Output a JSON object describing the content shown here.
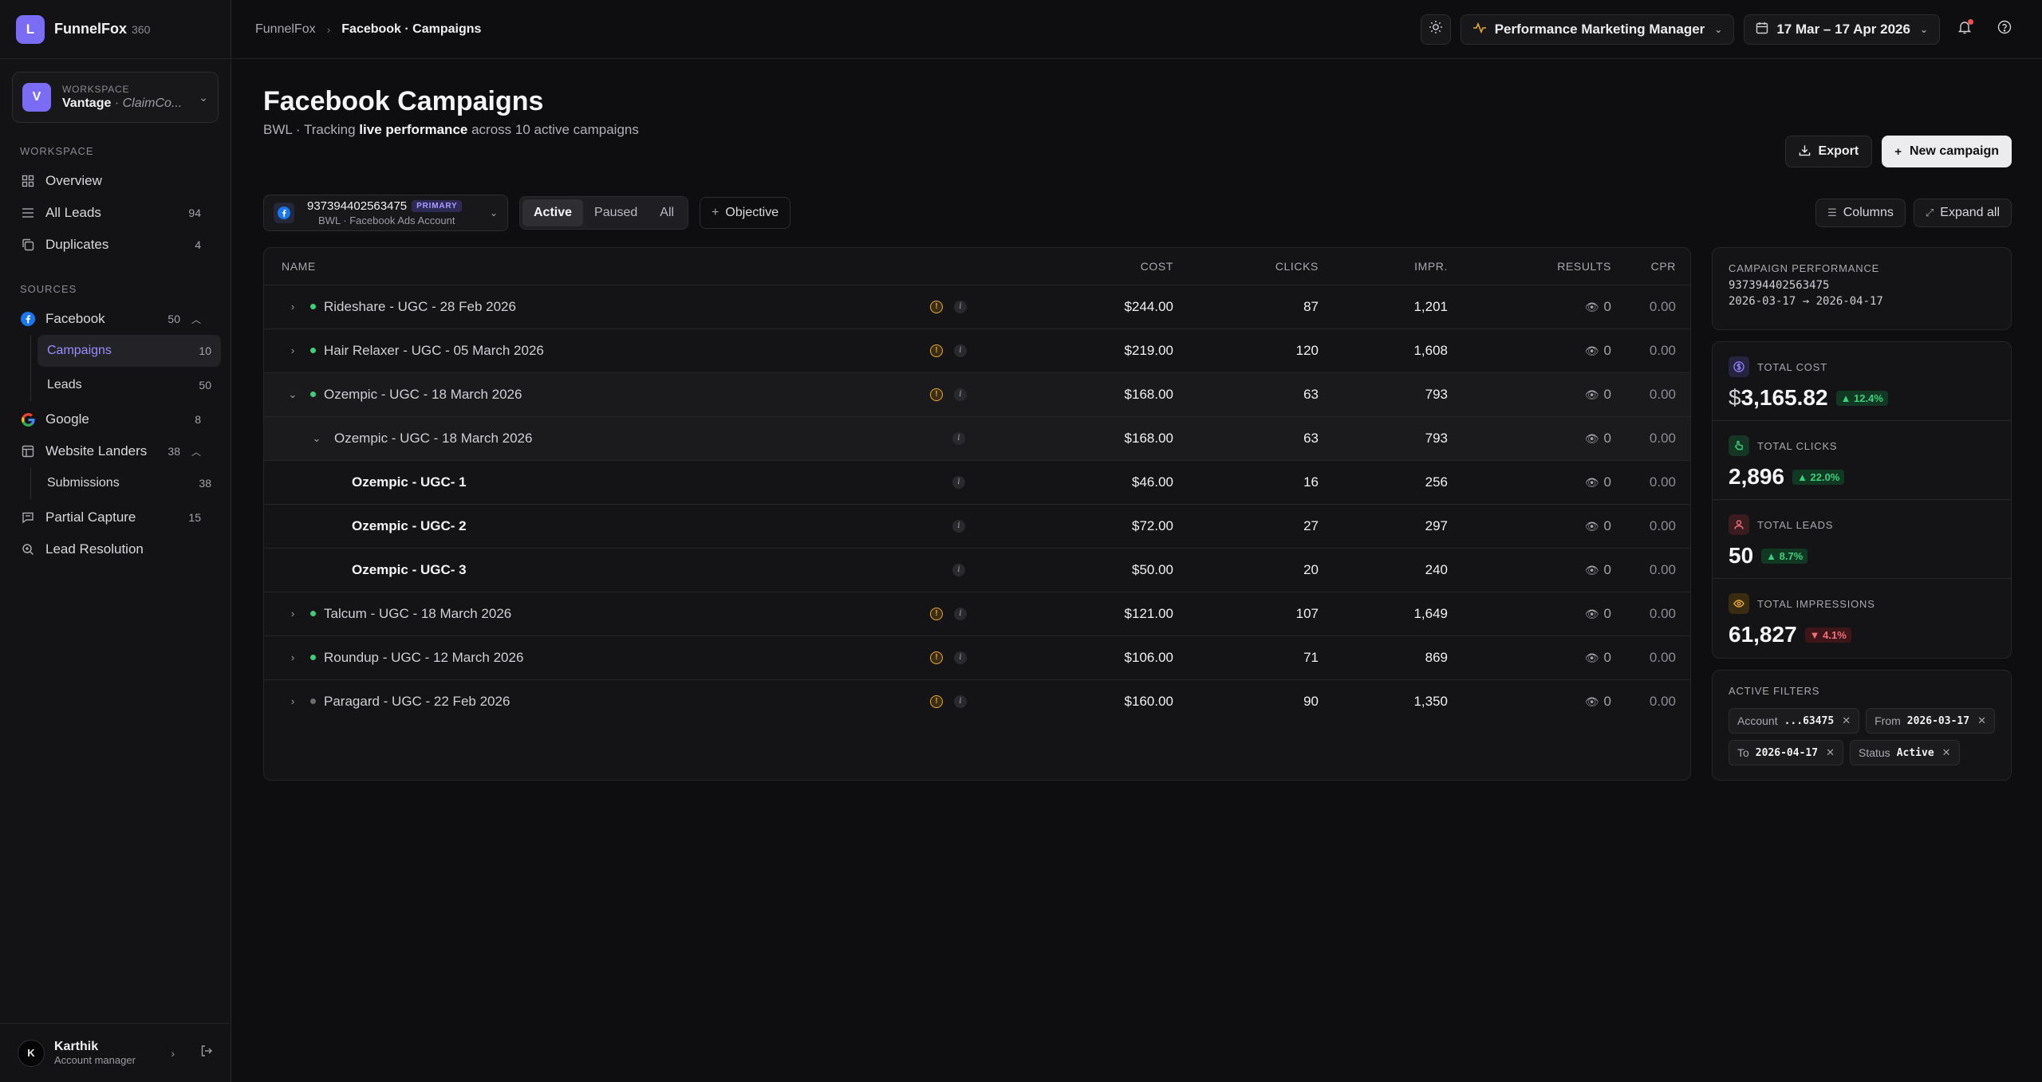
{
  "brand": {
    "logo": "L",
    "name": "FunnelFox",
    "version": "360"
  },
  "workspace": {
    "avatar": "V",
    "label": "WORKSPACE",
    "name": "Vantage",
    "sub": "· ClaimCo..."
  },
  "sidebar": {
    "section_workspace": "WORKSPACE",
    "section_sources": "SOURCES",
    "overview": {
      "label": "Overview",
      "icon": "grid-icon"
    },
    "all_leads": {
      "label": "All Leads",
      "count": "94",
      "icon": "list-icon"
    },
    "duplicates": {
      "label": "Duplicates",
      "count": "4",
      "icon": "copy-icon"
    },
    "facebook": {
      "label": "Facebook",
      "count": "50",
      "icon": "facebook-icon"
    },
    "campaigns": {
      "label": "Campaigns",
      "count": "10"
    },
    "leads": {
      "label": "Leads",
      "count": "50"
    },
    "google": {
      "label": "Google",
      "count": "8",
      "icon": "google-icon"
    },
    "website_landers": {
      "label": "Website Landers",
      "count": "38",
      "icon": "layout-icon"
    },
    "submissions": {
      "label": "Submissions",
      "count": "38"
    },
    "partial_capture": {
      "label": "Partial Capture",
      "count": "15",
      "icon": "message-icon"
    },
    "lead_resolution": {
      "label": "Lead Resolution",
      "icon": "search-icon"
    }
  },
  "user": {
    "initial": "K",
    "name": "Karthik",
    "role": "Account manager"
  },
  "topbar": {
    "crumb_root": "FunnelFox",
    "crumb_current": "Facebook · Campaigns",
    "role": "Performance Marketing Manager",
    "date_range": "17 Mar – 17 Apr 2026"
  },
  "page": {
    "title": "Facebook Campaigns",
    "sub_prefix": "BWL · Tracking ",
    "sub_bold": "live performance",
    "sub_suffix": " across 10 active campaigns",
    "export": "Export",
    "new_campaign": "New campaign"
  },
  "filters": {
    "account_id": "937394402563475",
    "account_pill": "PRIMARY",
    "account_sub": "BWL · Facebook Ads Account",
    "status_options": [
      "Active",
      "Paused",
      "All"
    ],
    "objective": "Objective",
    "columns": "Columns",
    "expand_all": "Expand all"
  },
  "table": {
    "headers": {
      "name": "NAME",
      "cost": "COST",
      "clicks": "CLICKS",
      "impr": "IMPR.",
      "results": "RESULTS",
      "cpr": "CPR"
    },
    "rows": [
      {
        "name": "Rideshare - UGC - 28 Feb 2026",
        "cost": "$244.00",
        "clicks": "87",
        "impr": "1,201",
        "results": "0",
        "cpr": "0.00"
      },
      {
        "name": "Hair Relaxer - UGC - 05 March 2026",
        "cost": "$219.00",
        "clicks": "120",
        "impr": "1,608",
        "results": "0",
        "cpr": "0.00"
      },
      {
        "name": "Ozempic - UGC - 18 March 2026",
        "cost": "$168.00",
        "clicks": "63",
        "impr": "793",
        "results": "0",
        "cpr": "0.00"
      },
      {
        "name": "Ozempic - UGC - 18 March 2026",
        "cost": "$168.00",
        "clicks": "63",
        "impr": "793",
        "results": "0",
        "cpr": "0.00"
      },
      {
        "name": "Ozempic - UGC- 1",
        "cost": "$46.00",
        "clicks": "16",
        "impr": "256",
        "results": "0",
        "cpr": "0.00"
      },
      {
        "name": "Ozempic - UGC- 2",
        "cost": "$72.00",
        "clicks": "27",
        "impr": "297",
        "results": "0",
        "cpr": "0.00"
      },
      {
        "name": "Ozempic - UGC- 3",
        "cost": "$50.00",
        "clicks": "20",
        "impr": "240",
        "results": "0",
        "cpr": "0.00"
      },
      {
        "name": "Talcum - UGC - 18 March 2026",
        "cost": "$121.00",
        "clicks": "107",
        "impr": "1,649",
        "results": "0",
        "cpr": "0.00"
      },
      {
        "name": "Roundup - UGC - 12 March 2026",
        "cost": "$106.00",
        "clicks": "71",
        "impr": "869",
        "results": "0",
        "cpr": "0.00"
      },
      {
        "name": "Paragard - UGC - 22 Feb 2026",
        "cost": "$160.00",
        "clicks": "90",
        "impr": "1,350",
        "results": "0",
        "cpr": "0.00"
      }
    ]
  },
  "panel": {
    "perf_label": "CAMPAIGN PERFORMANCE",
    "perf_account": "937394402563475",
    "perf_dates": "2026-03-17 → 2026-04-17",
    "stats": [
      {
        "label": "TOTAL COST",
        "value": "3,165.82",
        "currency": "$",
        "delta": "▲ 12.4%",
        "color": "#8a7cf8"
      },
      {
        "label": "TOTAL CLICKS",
        "value": "2,896",
        "delta": "▲ 22.0%",
        "color": "#3ecf7a"
      },
      {
        "label": "TOTAL LEADS",
        "value": "50",
        "delta": "▲ 8.7%",
        "color": "#f0707a"
      },
      {
        "label": "TOTAL IMPRESSIONS",
        "value": "61,827",
        "delta": "▼ 4.1%",
        "color": "#e8a93a"
      }
    ],
    "filters_label": "ACTIVE FILTERS",
    "chips": [
      {
        "key": "Account",
        "value": "...63475"
      },
      {
        "key": "From",
        "value": "2026-03-17"
      },
      {
        "key": "To",
        "value": "2026-04-17"
      },
      {
        "key": "Status",
        "value": "Active"
      }
    ]
  }
}
